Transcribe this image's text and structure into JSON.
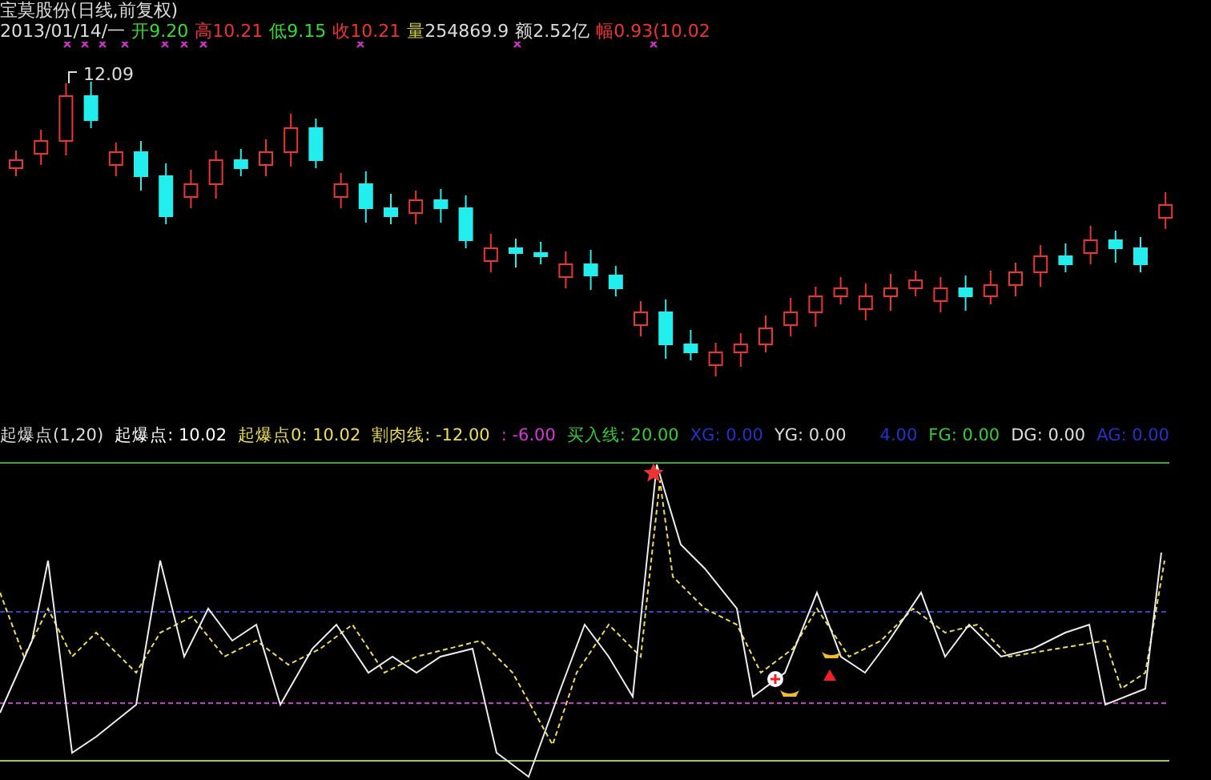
{
  "header": {
    "title": "宝莫股份(日线,前复权)",
    "date": "2013/01/14/一",
    "quote": [
      {
        "label": "开",
        "value": "9.20",
        "color": "#33dd33"
      },
      {
        "label": "高",
        "value": "10.21",
        "color": "#ee3333"
      },
      {
        "label": "低",
        "value": "9.15",
        "color": "#33dd33"
      },
      {
        "label": "收",
        "value": "10.21",
        "color": "#ee3333"
      },
      {
        "label": "量",
        "value": "254869.9",
        "color": "#cccc33"
      },
      {
        "label": "额",
        "value": "2.52亿",
        "color": "#dddddd"
      },
      {
        "label": "幅",
        "value": "0.93(10.02",
        "color": "#ee3333"
      }
    ]
  },
  "price_chart": {
    "high_label": "12.09"
  },
  "indicator": {
    "readouts": [
      {
        "text": "起爆点(1,20)",
        "color": "#dddddd"
      },
      {
        "text": "起爆点: 10.02",
        "color": "#ffffff"
      },
      {
        "text": "起爆点0: 10.02",
        "color": "#eedd55"
      },
      {
        "text": "割肉线: -12.00",
        "color": "#eedd55"
      },
      {
        "text": ": -6.00",
        "color": "#dd33dd"
      },
      {
        "text": "买入线: 20.00",
        "color": "#33cc33"
      },
      {
        "text": "XG: 0.00",
        "color": "#2233cc"
      },
      {
        "text": "YG: 0.00",
        "color": "#dddddd"
      },
      {
        "text": "4.00",
        "color": "#2233cc"
      },
      {
        "text": "FG: 0.00",
        "color": "#33cc33"
      },
      {
        "text": "DG: 0.00",
        "color": "#dddddd"
      },
      {
        "text": "AG: 0.00",
        "color": "#2233cc"
      }
    ]
  }
}
